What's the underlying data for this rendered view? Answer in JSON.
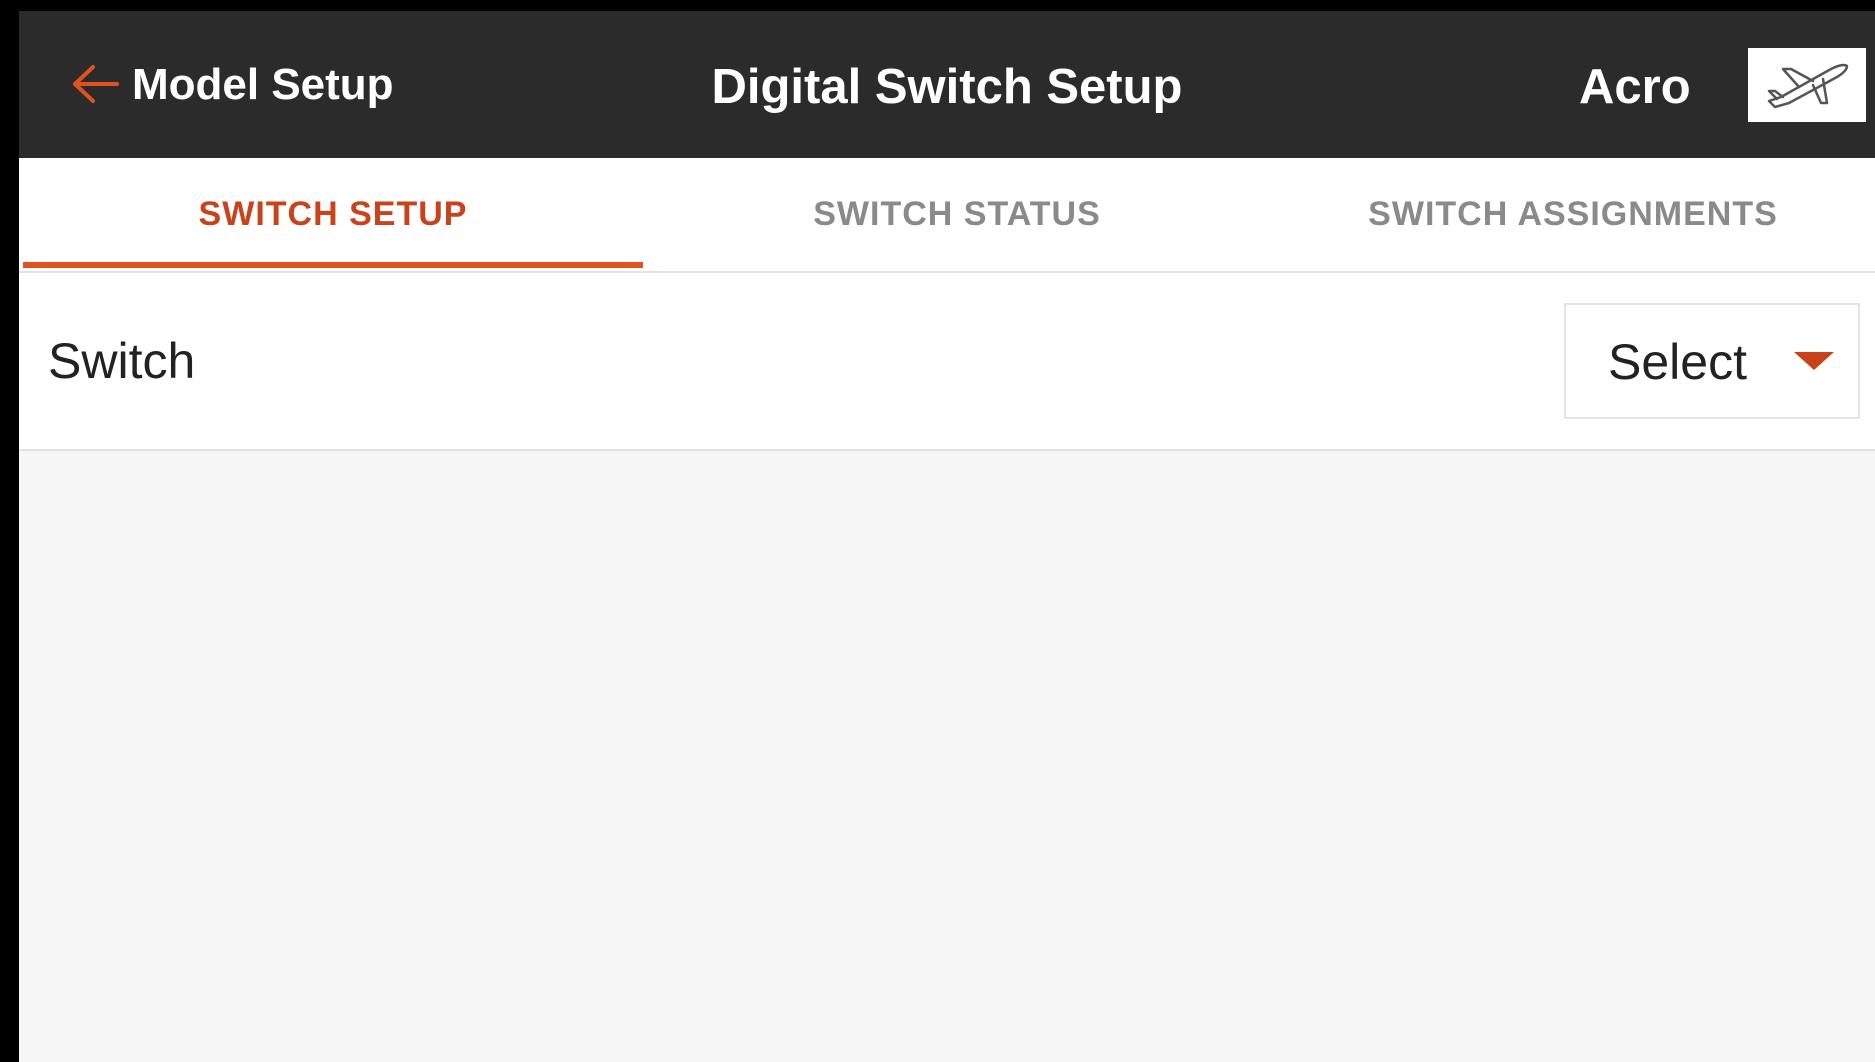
{
  "app_bar": {
    "back_label": "Model Setup",
    "title": "Digital Switch Setup",
    "model_name": "Acro",
    "back_icon": "arrow-left-icon",
    "model_icon": "airplane-icon"
  },
  "tabs": [
    {
      "label": "SWITCH SETUP",
      "active": true
    },
    {
      "label": "SWITCH STATUS",
      "active": false
    },
    {
      "label": "SWITCH ASSIGNMENTS",
      "active": false
    }
  ],
  "switch_row": {
    "label": "Switch",
    "select_value": "Select",
    "caret_icon": "caret-down-icon"
  },
  "colors": {
    "accent": "#e0531e",
    "accent_text": "#c8421a",
    "app_bar": "#2b2b2b",
    "background": "#f7f7f7"
  }
}
